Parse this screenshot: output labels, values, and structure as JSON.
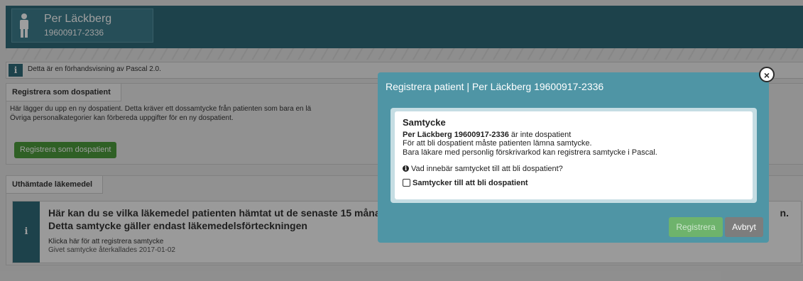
{
  "header": {
    "patient_name": "Per Läckberg",
    "patient_id": "19600917-2336"
  },
  "info_bar": {
    "icon": "info-icon",
    "text": "Detta är en förhandsvisning av Pascal 2.0."
  },
  "section_register": {
    "title": "Registrera som dospatient",
    "desc1": "Här lägger du upp en ny dospatient. Detta kräver ett dossamtycke från patienten som bara en lä",
    "desc2": "Övriga personalkategorier kan förbereda uppgifter för en ny dospatient.",
    "button": "Registrera som dospatient"
  },
  "section_uthamtade": {
    "title": "Uthämtade läkemedel",
    "alert_line1": "Här kan du se vilka läkemedel patienten hämtat ut de senaste 15 månad",
    "alert_line2": "Detta samtycke gäller endast läkemedelsförteckningen",
    "alert_tail": "n.",
    "alert_link": "Klicka här för att registrera samtycke",
    "alert_note": "Givet samtycke återkallades 2017-01-02"
  },
  "modal": {
    "title": "Registrera patient | Per Läckberg 19600917-2336",
    "card_title": "Samtycke",
    "line1_bold": "Per Läckberg 19600917-2336",
    "line1_rest": " är inte dospatient",
    "line2": "För att bli dospatient måste patienten lämna samtycke.",
    "line3": "Bara läkare med personlig förskrivarkod kan registrera samtycke i Pascal.",
    "question": "Vad innebär samtycket till att bli dospatient?",
    "checkbox_label": "Samtycker till att bli dospatient",
    "register_button": "Registrera",
    "cancel_button": "Avbryt"
  },
  "colors": {
    "header": "#2f6b7a",
    "modal": "#4f95a5",
    "primary_green": "#4c9b3c",
    "cancel_grey": "#7d7d7d"
  }
}
